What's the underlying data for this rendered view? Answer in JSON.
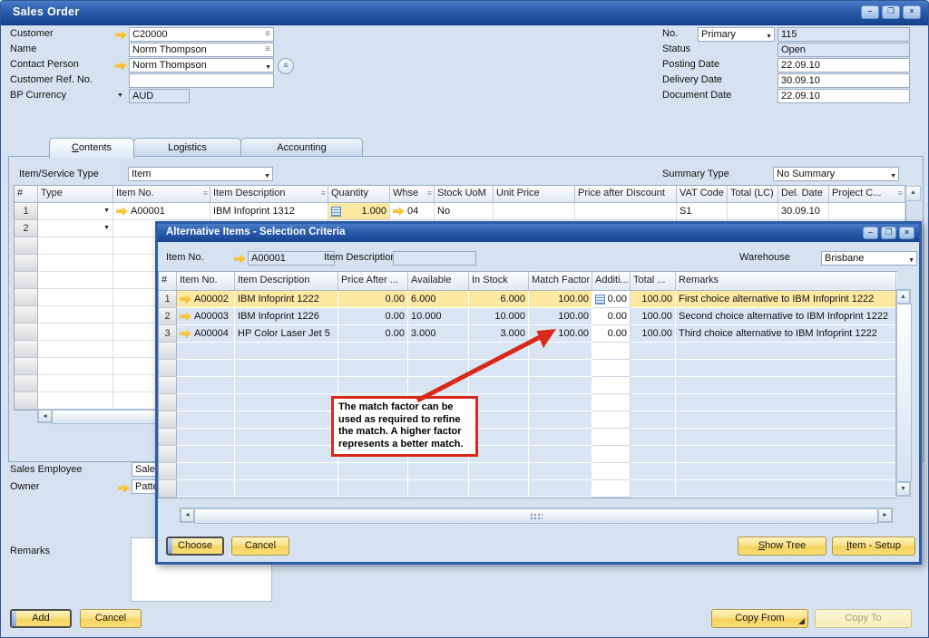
{
  "window": {
    "title": "Sales Order"
  },
  "icons": {
    "minimize": "–",
    "maximize": "❐",
    "close": "×",
    "dropdown": "▼",
    "list_lines": "≡",
    "scroll_left": "◄",
    "scroll_right": "►",
    "scroll_up": "▲",
    "scroll_down": "▼"
  },
  "header": {
    "customer_label": "Customer",
    "customer_value": "C20000",
    "name_label": "Name",
    "name_value": "Norm Thompson",
    "contact_label": "Contact Person",
    "contact_value": "Norm Thompson",
    "ref_label": "Customer Ref. No.",
    "ref_value": "",
    "currency_label": "BP Currency",
    "currency_value": "AUD",
    "no_label": "No.",
    "no_series": "Primary",
    "no_value": "115",
    "status_label": "Status",
    "status_value": "Open",
    "posting_label": "Posting Date",
    "posting_value": "22.09.10",
    "delivery_label": "Delivery Date",
    "delivery_value": "30.09.10",
    "docdate_label": "Document Date",
    "docdate_value": "22.09.10"
  },
  "tabs": {
    "contents": "Contents",
    "logistics": "Logistics",
    "accounting": "Accounting"
  },
  "toolbar": {
    "item_service_label": "Item/Service Type",
    "item_service_value": "Item",
    "summary_label": "Summary Type",
    "summary_value": "No Summary"
  },
  "main_grid": {
    "headers": {
      "num": "#",
      "type": "Type",
      "item_no": "Item No.",
      "desc": "Item Description",
      "qty": "Quantity",
      "whse": "Whse",
      "uom": "Stock UoM",
      "unit_price": "Unit Price",
      "pad": "Price after Discount",
      "vat": "VAT Code",
      "total": "Total (LC)",
      "del_date": "Del. Date",
      "project": "Project C..."
    },
    "rows": [
      {
        "num": "1",
        "item_no": "A00001",
        "desc": "IBM Infoprint 1312",
        "qty": "1.000",
        "whse": "04",
        "uom": "No",
        "vat": "S1",
        "del_date": "30.09.10"
      },
      {
        "num": "2"
      }
    ]
  },
  "footer": {
    "sales_employee_label": "Sales Employee",
    "sales_employee_value": "Sales",
    "owner_label": "Owner",
    "owner_value": "Patte",
    "remarks_label": "Remarks",
    "add": "Add",
    "cancel": "Cancel",
    "copy_from": "Copy From",
    "copy_to": "Copy To"
  },
  "dialog": {
    "title": "Alternative Items - Selection Criteria",
    "item_no_label": "Item No.",
    "item_no_value": "A00001",
    "item_desc_label": "Item Description",
    "item_desc_value": "",
    "warehouse_label": "Warehouse",
    "warehouse_value": "Brisbane",
    "grid": {
      "headers": {
        "num": "#",
        "item_no": "Item No.",
        "desc": "Item Description",
        "price_after": "Price After ...",
        "available": "Available",
        "in_stock": "In Stock",
        "match": "Match Factor",
        "additional": "Additi...",
        "total": "Total ...",
        "remarks": "Remarks"
      },
      "rows": [
        {
          "num": "1",
          "item_no": "A00002",
          "desc": "IBM Infoprint 1222",
          "price_after": "0.00",
          "available": "6.000",
          "in_stock": "6.000",
          "match": "100.00",
          "additional": "0.00",
          "total": "100.00",
          "remarks": "First choice alternative to IBM Infoprint 1222"
        },
        {
          "num": "2",
          "item_no": "A00003",
          "desc": "IBM Infoprint 1226",
          "price_after": "0.00",
          "available": "10.000",
          "in_stock": "10.000",
          "match": "100.00",
          "additional": "0.00",
          "total": "100.00",
          "remarks": "Second choice alternative to IBM Infoprint 1222"
        },
        {
          "num": "3",
          "item_no": "A00004",
          "desc": "HP Color Laser Jet 5",
          "price_after": "0.00",
          "available": "3.000",
          "in_stock": "3.000",
          "match": "100.00",
          "additional": "0.00",
          "total": "100.00",
          "remarks": "Third choice alternative to IBM Infoprint 1222"
        }
      ]
    },
    "buttons": {
      "choose": "Choose",
      "cancel": "Cancel",
      "show_tree": "Show Tree",
      "item_setup": "Item - Setup"
    }
  },
  "annotation": {
    "text": "The match factor can be used as required to refine the match. A higher factor represents a better match."
  },
  "colors": {
    "title_blue_light": "#4a7cc7",
    "title_blue_dark": "#16438f",
    "window_bg": "#d6e2ef",
    "row_blue": "#d9e5f2",
    "selection_yellow": "#fde9a2",
    "button_yellow": "#f8dc74",
    "link_arrow_orange": "#f3ae0c",
    "annotation_red": "#d9291b"
  }
}
